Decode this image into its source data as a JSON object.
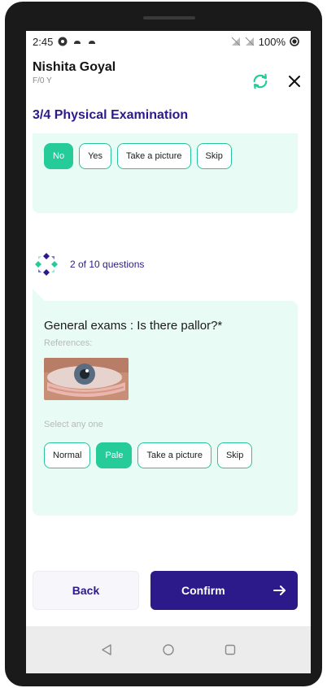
{
  "status_bar": {
    "time": "2:45",
    "battery": "100%"
  },
  "header": {
    "patient_name": "Nishita Goyal",
    "patient_meta": "F/0 Y",
    "sync_icon": "sync-icon",
    "close_icon": "close-icon"
  },
  "section": {
    "title": "3/4 Physical Examination"
  },
  "previous_question": {
    "options": [
      {
        "label": "No",
        "selected": true
      },
      {
        "label": "Yes",
        "selected": false
      },
      {
        "label": "Take a picture",
        "selected": false
      },
      {
        "label": "Skip",
        "selected": false
      }
    ]
  },
  "assistant": {
    "progress_text": "2 of 10 questions"
  },
  "current_question": {
    "question": "General exams : Is there pallor?*",
    "references_label": "References:",
    "reference_image": "eye-pallor-reference-image",
    "select_hint": "Select any one",
    "options": [
      {
        "label": "Normal",
        "selected": false
      },
      {
        "label": "Pale",
        "selected": true
      },
      {
        "label": "Take a picture",
        "selected": false
      },
      {
        "label": "Skip",
        "selected": false
      }
    ]
  },
  "footer": {
    "back_label": "Back",
    "confirm_label": "Confirm"
  },
  "colors": {
    "primary": "#2c1a8a",
    "accent": "#25cb99",
    "card_bg": "#e9fbf5"
  }
}
